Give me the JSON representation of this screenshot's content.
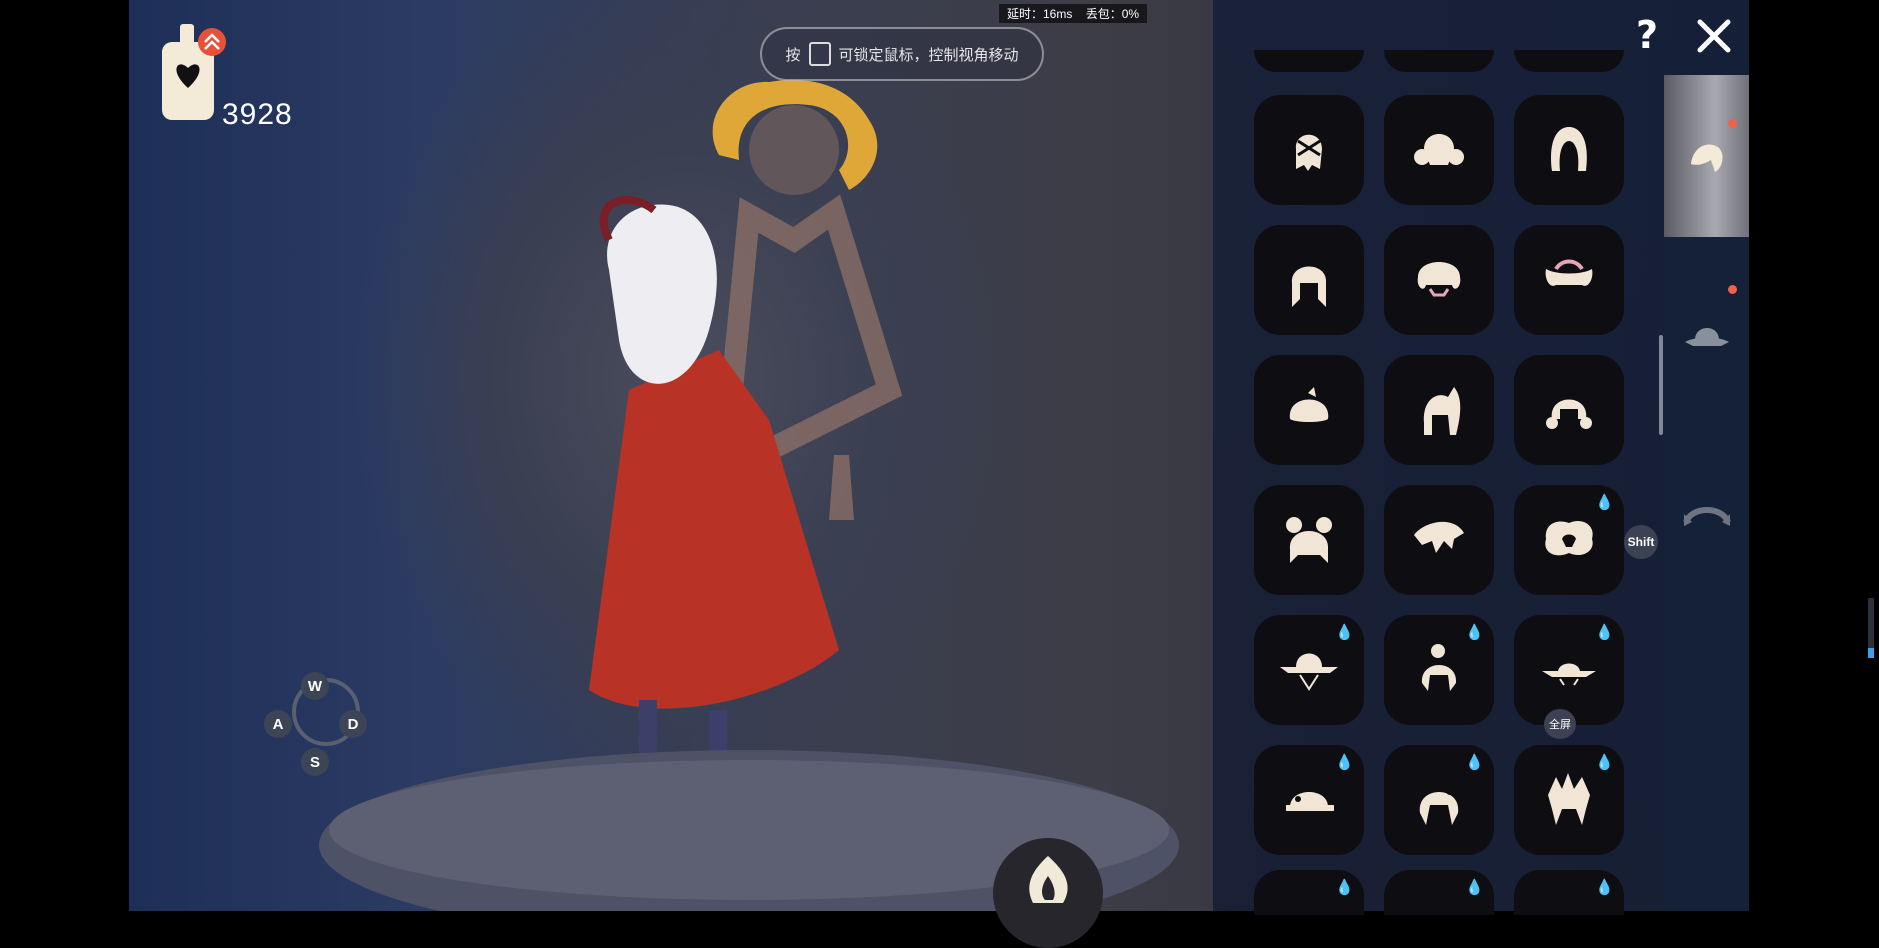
{
  "stats": {
    "latency": "延时：16ms",
    "packet_loss": "丢包：0%"
  },
  "hint": {
    "press": "按",
    "text": "可锁定鼠标，控制视角移动"
  },
  "candles": {
    "count": "3928"
  },
  "keys": {
    "w": "W",
    "a": "A",
    "s": "S",
    "d": "D",
    "shift": "Shift",
    "fullscreen": "全屏"
  },
  "panel": {
    "tabs": [
      {
        "icon": "hair-icon",
        "active": true,
        "new": true
      },
      {
        "icon": "hat-icon",
        "active": false,
        "new": true
      },
      {
        "icon": "headband-icon",
        "active": false,
        "new": false
      }
    ],
    "items": [
      {
        "icon": "hair-wrap-icon",
        "drop": false
      },
      {
        "icon": "hair-twin-buns-icon",
        "drop": false
      },
      {
        "icon": "hair-long-icon",
        "drop": false
      },
      {
        "icon": "hair-braids-icon",
        "drop": false
      },
      {
        "icon": "hair-curly-icon",
        "drop": false
      },
      {
        "icon": "hair-pigtails-icon",
        "drop": false
      },
      {
        "icon": "hair-bob-icon",
        "drop": false
      },
      {
        "icon": "hair-ponytail-icon",
        "drop": false
      },
      {
        "icon": "hair-side-buns-icon",
        "drop": false
      },
      {
        "icon": "hair-double-buns-icon",
        "drop": false
      },
      {
        "icon": "hair-messy-icon",
        "drop": false
      },
      {
        "icon": "hair-fluffy-icon",
        "drop": true
      },
      {
        "icon": "wide-hat-icon",
        "drop": true
      },
      {
        "icon": "hair-top-bun-icon",
        "drop": true
      },
      {
        "icon": "flat-hat-icon",
        "drop": true
      },
      {
        "icon": "cap-icon",
        "drop": true
      },
      {
        "icon": "hair-flower-crown-icon",
        "drop": true
      },
      {
        "icon": "hair-spiky-icon",
        "drop": true
      }
    ],
    "drop_glyph": "💧"
  },
  "colors": {
    "accent_dot": "#f0604a",
    "item_fill": "#f1e6d6",
    "halo": "#f2b234"
  }
}
